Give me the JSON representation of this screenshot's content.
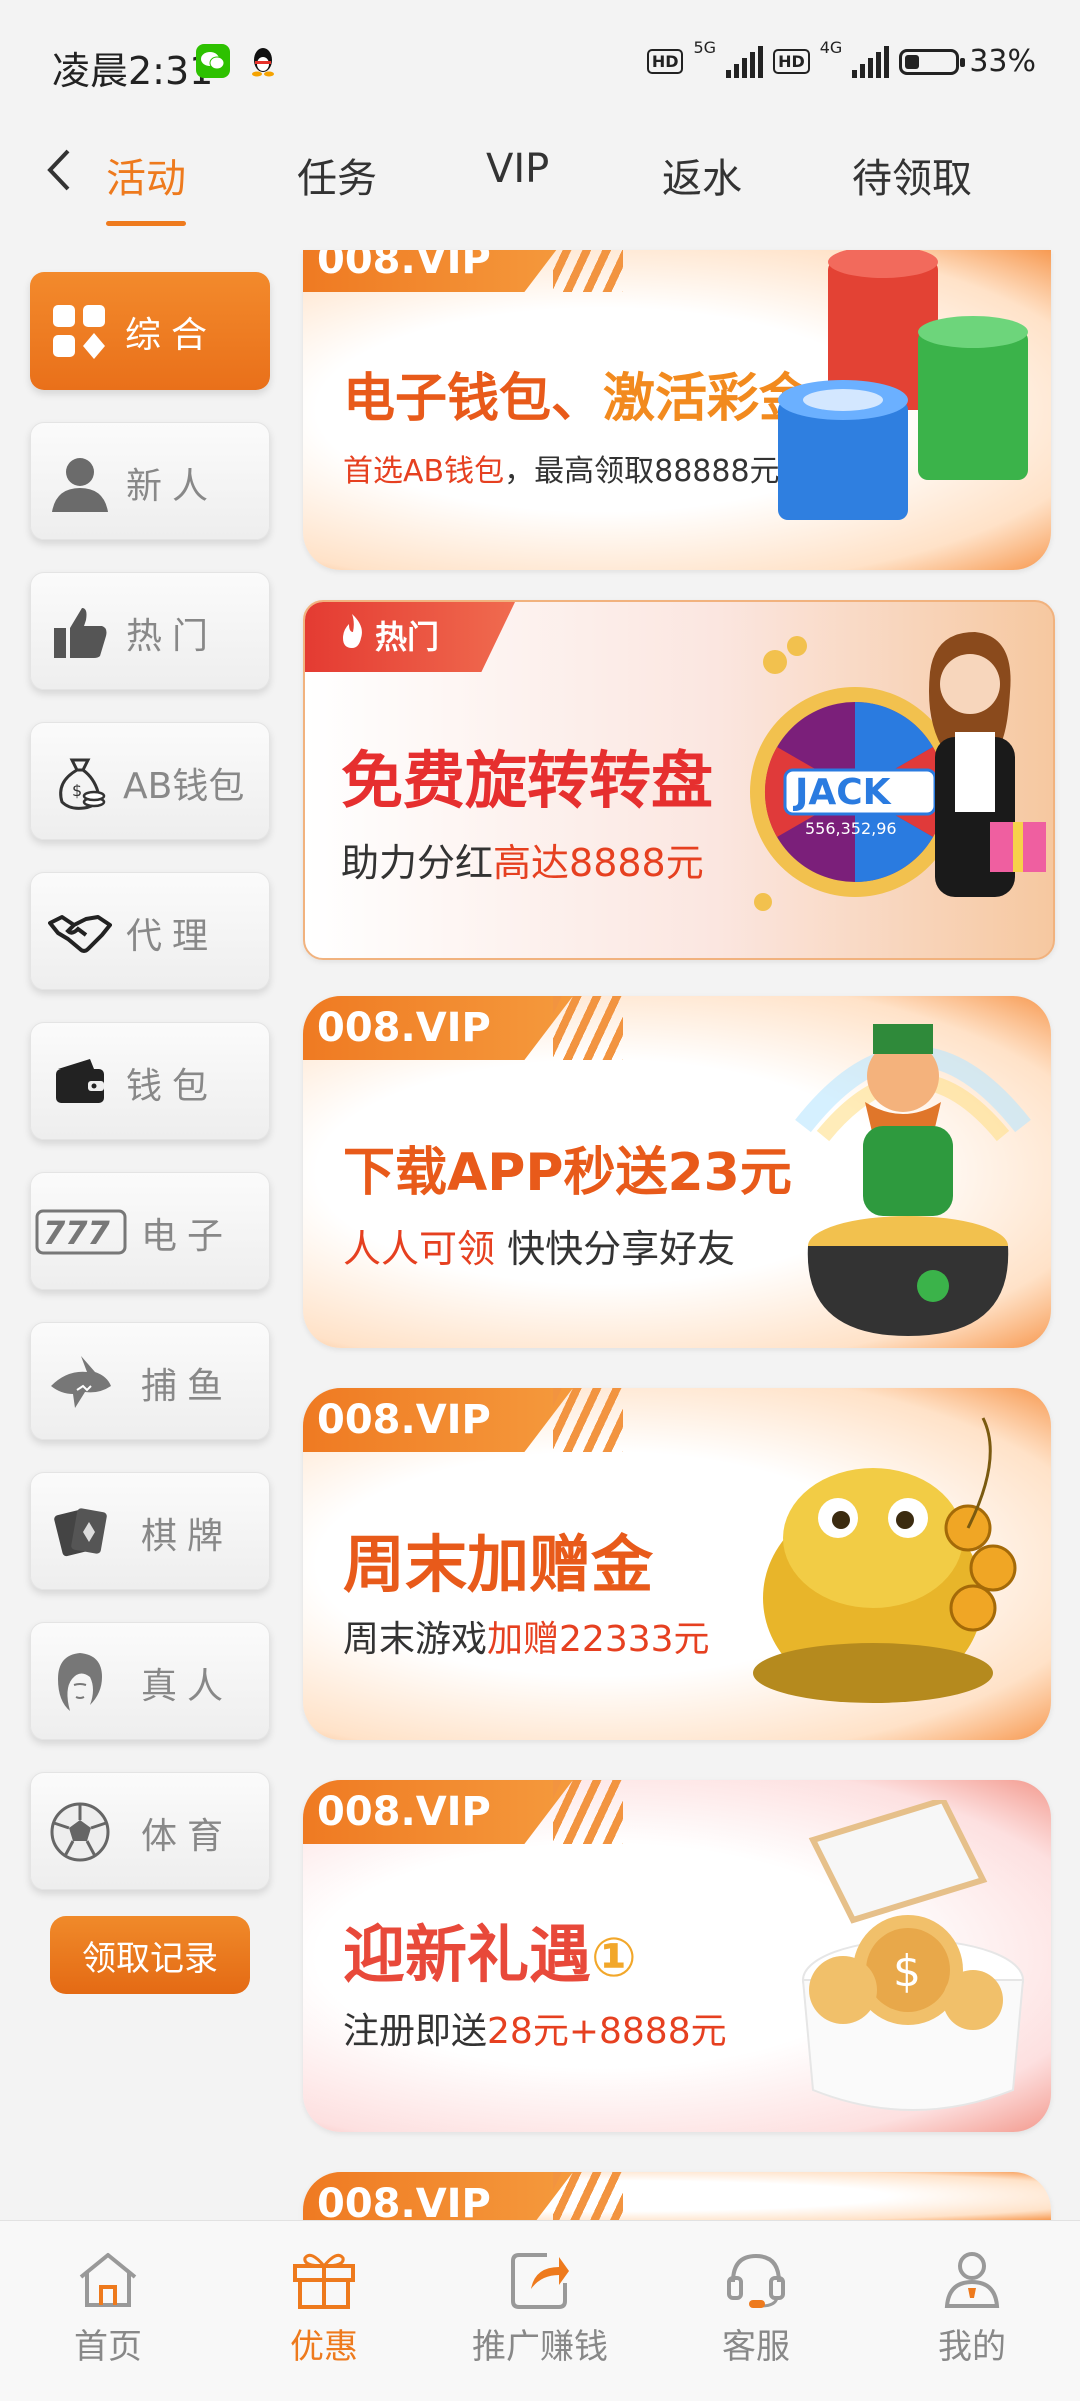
{
  "status_bar": {
    "time": "凌晨2:31",
    "hd1": "HD",
    "net1": "5G",
    "hd2": "HD",
    "net2": "4G",
    "battery": "33%"
  },
  "top_tabs": [
    {
      "label": "活动",
      "active": true
    },
    {
      "label": "任务",
      "active": false
    },
    {
      "label": "VIP",
      "active": false
    },
    {
      "label": "返水",
      "active": false
    },
    {
      "label": "待领取",
      "active": false
    }
  ],
  "sidebar": {
    "items": [
      {
        "label": "综合",
        "icon": "grid-icon",
        "active": true
      },
      {
        "label": "新人",
        "icon": "person-icon"
      },
      {
        "label": "热门",
        "icon": "thumbs-up-icon"
      },
      {
        "label": "AB钱包",
        "icon": "money-bag-icon"
      },
      {
        "label": "代理",
        "icon": "handshake-icon"
      },
      {
        "label": "钱包",
        "icon": "wallet-icon"
      },
      {
        "label": "电子",
        "icon": "slot-777-icon"
      },
      {
        "label": "捕鱼",
        "icon": "shark-icon"
      },
      {
        "label": "棋牌",
        "icon": "cards-icon"
      },
      {
        "label": "真人",
        "icon": "woman-face-icon"
      },
      {
        "label": "体育",
        "icon": "soccer-ball-icon"
      }
    ],
    "record_button": "领取记录"
  },
  "banners": [
    {
      "tag": "008.VIP",
      "title_a": "电子钱包、",
      "title_b": "激活彩金",
      "sub_a": "首选AB钱包",
      "sub_b": "，最高领取88888元"
    },
    {
      "tag": "热门",
      "title": "免费旋转转盘",
      "sub_a": "助力分红",
      "sub_b": "高达8888元",
      "wheel_text": "JACK",
      "wheel_amount": "556,352,96"
    },
    {
      "tag": "008.VIP",
      "title": "下载APP秒送23元",
      "sub_a": "人人可领",
      "sub_b": "快快分享好友"
    },
    {
      "tag": "008.VIP",
      "title": "周末加赠金",
      "sub_a": "周末游戏",
      "sub_b": "加赠22333元"
    },
    {
      "tag": "008.VIP",
      "title": "迎新礼遇",
      "title_badge": "①",
      "sub_a": "注册即送",
      "sub_b": "28元+8888元"
    },
    {
      "tag": "008.VIP"
    }
  ],
  "bottom_nav": [
    {
      "label": "首页",
      "icon": "home-icon"
    },
    {
      "label": "优惠",
      "icon": "gift-icon",
      "active": true
    },
    {
      "label": "推广赚钱",
      "icon": "share-icon"
    },
    {
      "label": "客服",
      "icon": "headset-icon"
    },
    {
      "label": "我的",
      "icon": "user-icon"
    }
  ],
  "colors": {
    "accent": "#ee7a1d",
    "highlight_red": "#e64020",
    "hot_red": "#e43b32"
  }
}
